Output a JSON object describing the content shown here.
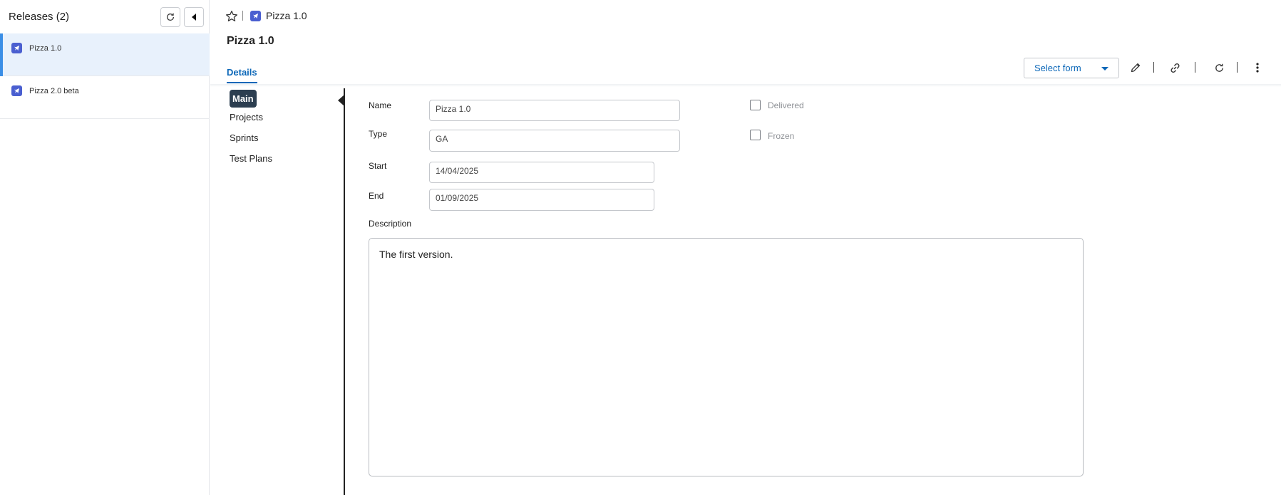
{
  "sidebar": {
    "title": "Releases (2)",
    "items": [
      {
        "label": "Pizza 1.0",
        "icon": "release-icon",
        "active": true
      },
      {
        "label": "Pizza 2.0 beta",
        "icon": "release-icon",
        "active": false
      }
    ]
  },
  "header": {
    "breadcrumb": "Pizza 1.0",
    "title": "Pizza 1.0",
    "tab": "Details",
    "select_form": "Select form"
  },
  "section_nav": [
    "Main",
    "Projects",
    "Sprints",
    "Test Plans"
  ],
  "form": {
    "name": {
      "label": "Name",
      "value": "Pizza 1.0"
    },
    "type": {
      "label": "Type",
      "value": "GA"
    },
    "start": {
      "label": "Start",
      "value": "14/04/2025"
    },
    "end": {
      "label": "End",
      "value": "01/09/2025"
    },
    "delivered": {
      "label": "Delivered",
      "checked": false
    },
    "frozen": {
      "label": "Frozen",
      "checked": false
    },
    "description": {
      "label": "Description",
      "value": "The first version."
    }
  },
  "colors": {
    "accent": "#0b67b8",
    "active_row": "#e8f1fc",
    "active_bar": "#3a8ee6",
    "release_icon": "#4a5fd0",
    "nav_active": "#2c3e50"
  }
}
